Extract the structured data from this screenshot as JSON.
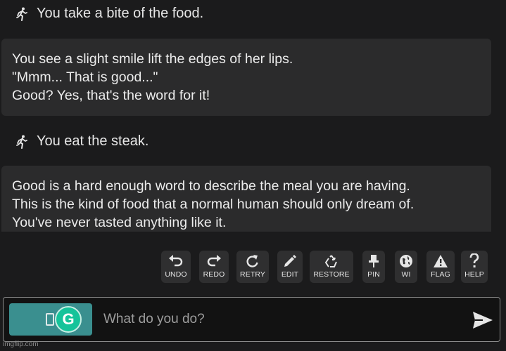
{
  "story": {
    "action1": "You take a bite of the food.",
    "msg1": [
      "You see a slight smile lift the edges of her lips.",
      "\"Mmm... That is good...\"",
      "Good? Yes, that's the word for it!"
    ],
    "action2": "You eat the steak.",
    "msg2": [
      "Good is a hard enough word to describe the meal you are having.",
      "This is the kind of food that a normal human should only dream of.",
      "You've never tasted anything like it."
    ]
  },
  "toolbar": {
    "undo": "UNDO",
    "redo": "REDO",
    "retry": "RETRY",
    "edit": "EDIT",
    "restore": "RESTORE",
    "pin": "PIN",
    "wi": "WI",
    "flag": "FLAG",
    "help": "HELP"
  },
  "icons": {
    "action": "running-person-icon",
    "undo": "undo-arrow-icon",
    "redo": "redo-arrow-icon",
    "retry": "refresh-icon",
    "edit": "pencil-icon",
    "restore": "recycle-icon",
    "pin": "pushpin-icon",
    "wi": "globe-icon",
    "flag": "warning-triangle-icon",
    "help": "question-mark-icon",
    "send": "send-icon"
  },
  "input": {
    "placeholder": "What do you do?",
    "grammarly_letter": "G"
  },
  "colors": {
    "background": "#1b1b1c",
    "message_bg": "#2b2b2c",
    "mode_button": "#3a8f8f",
    "grammarly": "#15c39a"
  },
  "watermark": "imgflip.com"
}
